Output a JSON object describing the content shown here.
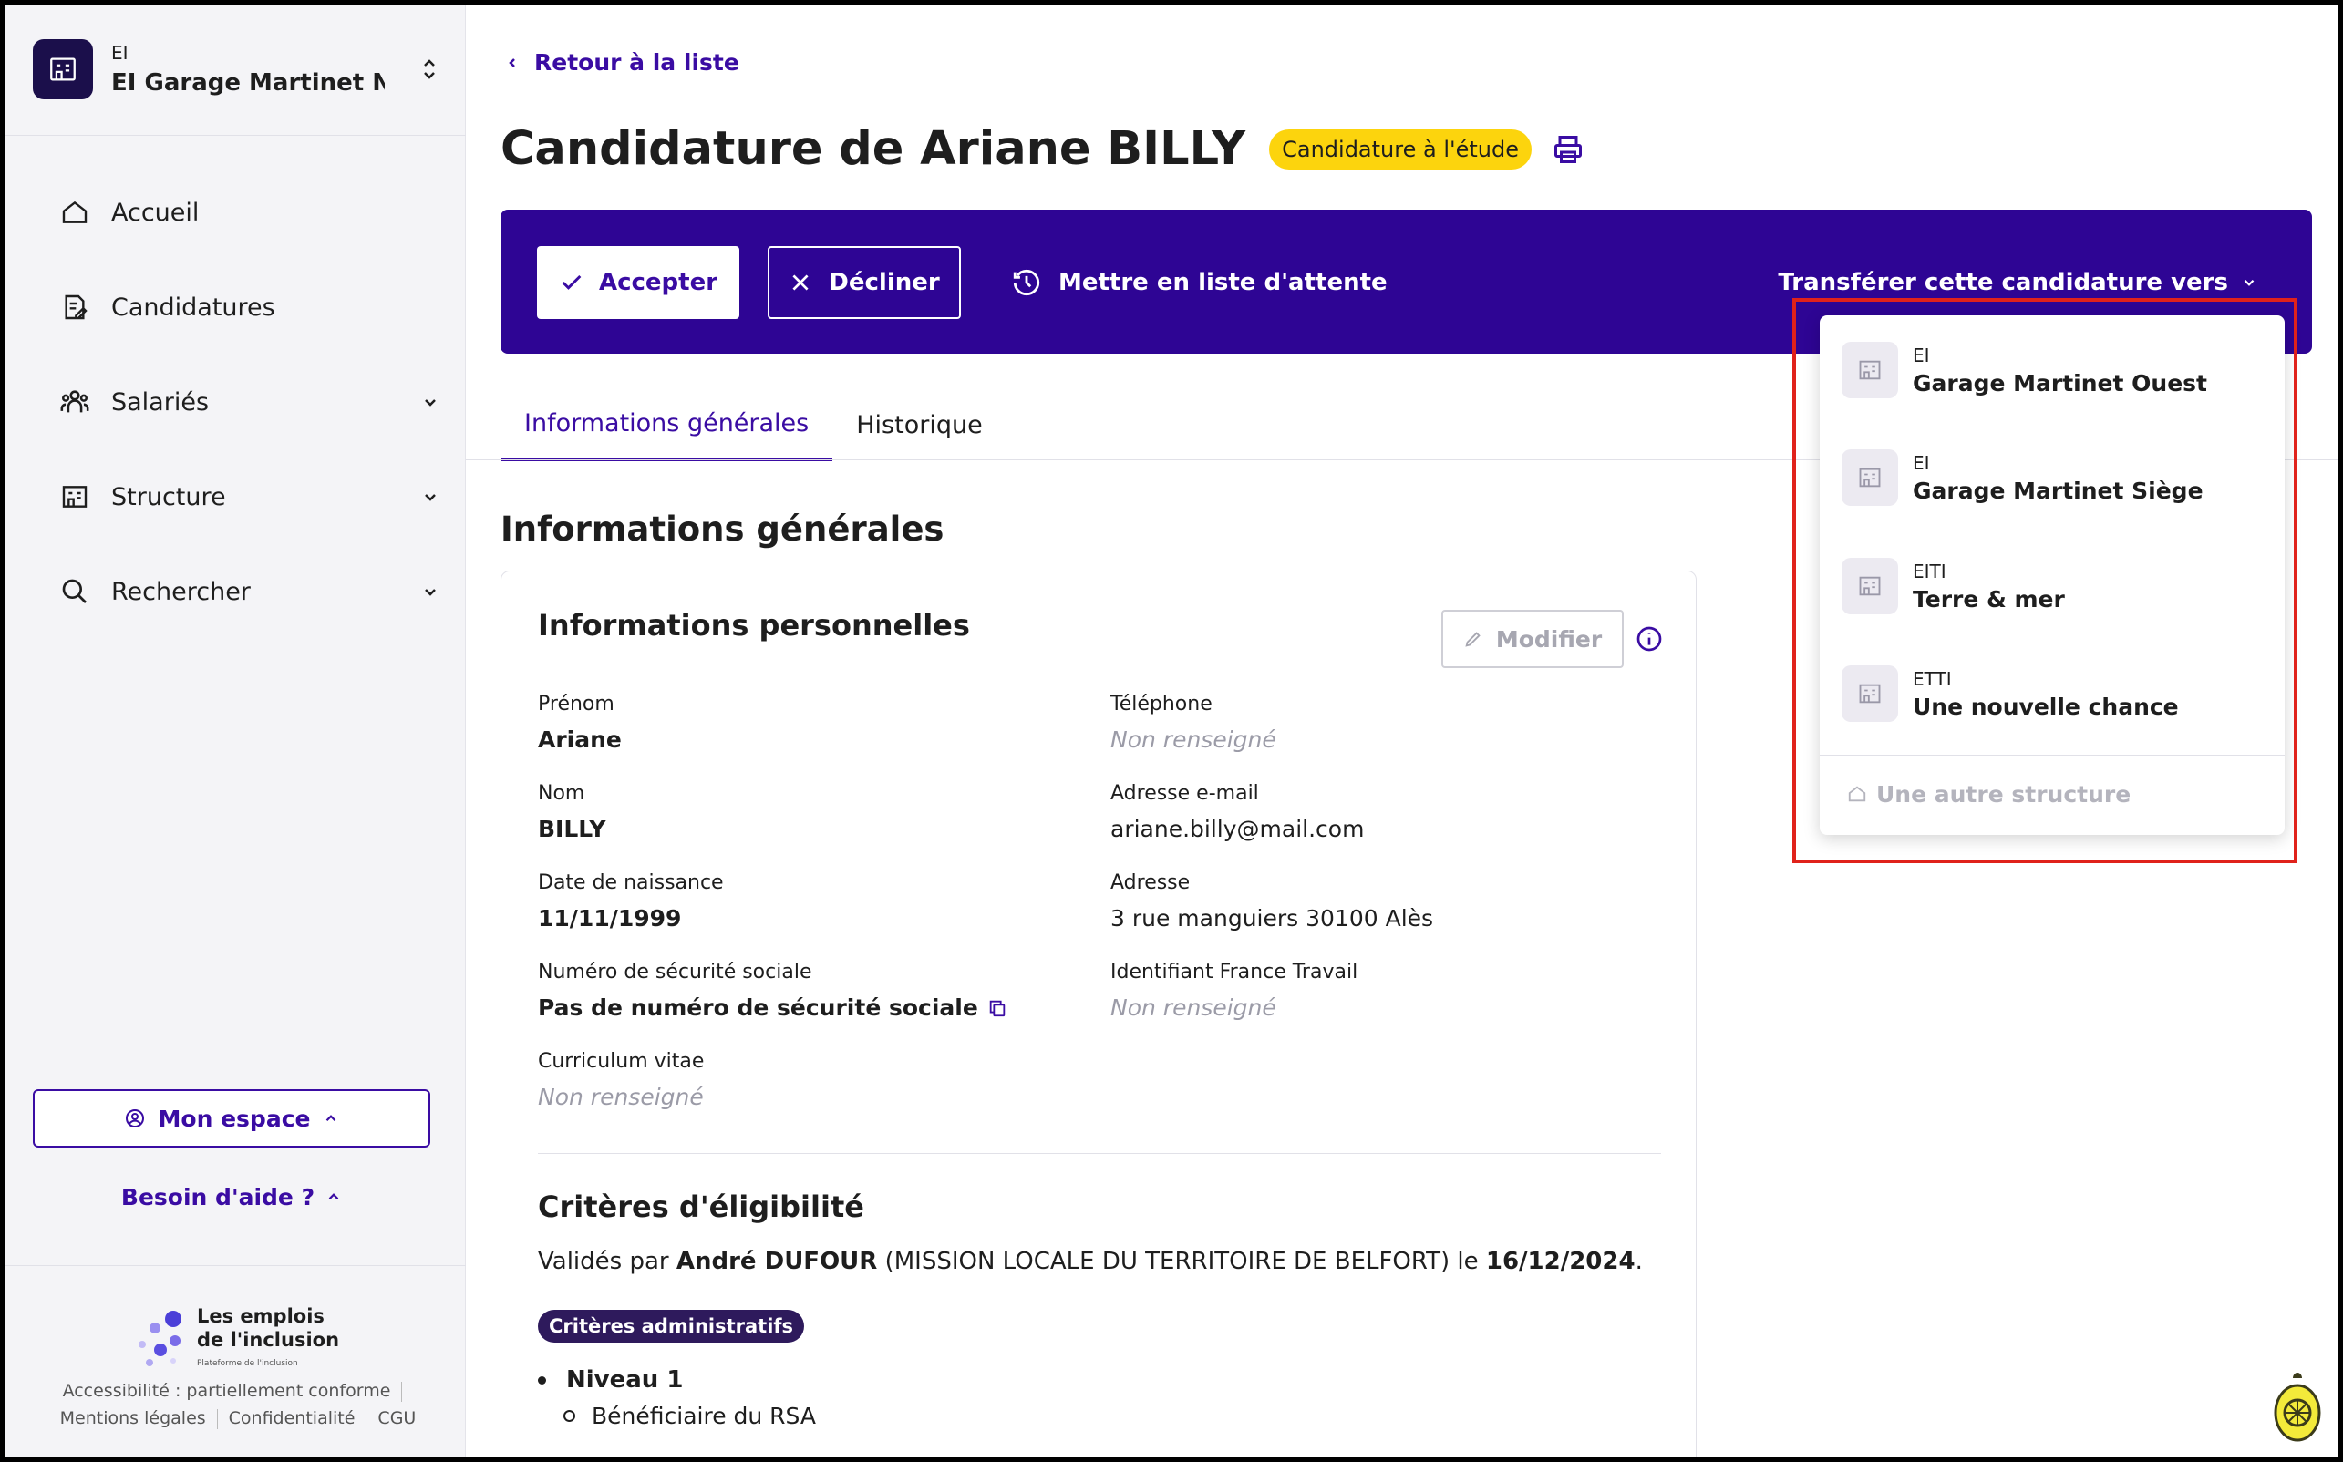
{
  "org": {
    "kind": "EI",
    "name": "EI Garage Martinet N..."
  },
  "sidebar": {
    "items": [
      {
        "label": "Accueil",
        "icon": "home-icon",
        "has_submenu": false
      },
      {
        "label": "Candidatures",
        "icon": "file-edit-icon",
        "has_submenu": false
      },
      {
        "label": "Salariés",
        "icon": "team-icon",
        "has_submenu": true
      },
      {
        "label": "Structure",
        "icon": "building-icon",
        "has_submenu": true
      },
      {
        "label": "Rechercher",
        "icon": "search-icon",
        "has_submenu": true
      }
    ],
    "mon_espace": "Mon espace",
    "aide": "Besoin d'aide ?"
  },
  "brand": {
    "line1": "Les emplois",
    "line2": "de l'inclusion",
    "tagline": "Plateforme de l'inclusion"
  },
  "footer": {
    "accessibility": "Accessibilité : partiellement conforme",
    "legal": "Mentions légales",
    "privacy": "Confidentialité",
    "cgu": "CGU"
  },
  "back_label": "Retour à la liste",
  "page_title": "Candidature de Ariane BILLY",
  "status_badge": "Candidature à l'étude",
  "actions": {
    "accept": "Accepter",
    "decline": "Décliner",
    "waitlist": "Mettre en liste d'attente",
    "transfer": "Transférer cette candidature vers"
  },
  "tabs": [
    {
      "label": "Informations générales",
      "active": true
    },
    {
      "label": "Historique",
      "active": false
    }
  ],
  "section_title": "Informations générales",
  "personal": {
    "title": "Informations personnelles",
    "modify": "Modifier",
    "fields": {
      "prenom": {
        "label": "Prénom",
        "value": "Ariane"
      },
      "telephone": {
        "label": "Téléphone",
        "value": "Non renseigné"
      },
      "nom": {
        "label": "Nom",
        "value": "BILLY"
      },
      "email": {
        "label": "Adresse e-mail",
        "value": "ariane.billy@mail.com"
      },
      "naissance": {
        "label": "Date de naissance",
        "value": "11/11/1999"
      },
      "adresse": {
        "label": "Adresse",
        "value": "3 rue manguiers 30100 Alès"
      },
      "secu": {
        "label": "Numéro de sécurité sociale",
        "value": "Pas de numéro de sécurité sociale"
      },
      "ft": {
        "label": "Identifiant France Travail",
        "value": "Non renseigné"
      },
      "cv": {
        "label": "Curriculum vitae",
        "value": "Non renseigné"
      }
    }
  },
  "eligibility": {
    "title": "Critères d'éligibilité",
    "prefix": "Validés par ",
    "validator": "André DUFOUR",
    "org": " (MISSION LOCALE DU TERRITOIRE DE BELFORT) le ",
    "date": "16/12/2024",
    "suffix": ".",
    "chip": "Critères administratifs",
    "level": "Niveau 1",
    "criterion": "Bénéficiaire du RSA"
  },
  "transfer_menu": {
    "items": [
      {
        "kind": "EI",
        "name": "Garage Martinet Ouest"
      },
      {
        "kind": "EI",
        "name": "Garage Martinet Siège"
      },
      {
        "kind": "EITI",
        "name": "Terre & mer"
      },
      {
        "kind": "ETTI",
        "name": "Une nouvelle chance"
      }
    ],
    "other": "Une autre structure"
  },
  "colors": {
    "primary": "#3a0ca3",
    "action_bar": "#2e0594",
    "badge": "#fcd40d",
    "highlight": "#e0221b"
  }
}
